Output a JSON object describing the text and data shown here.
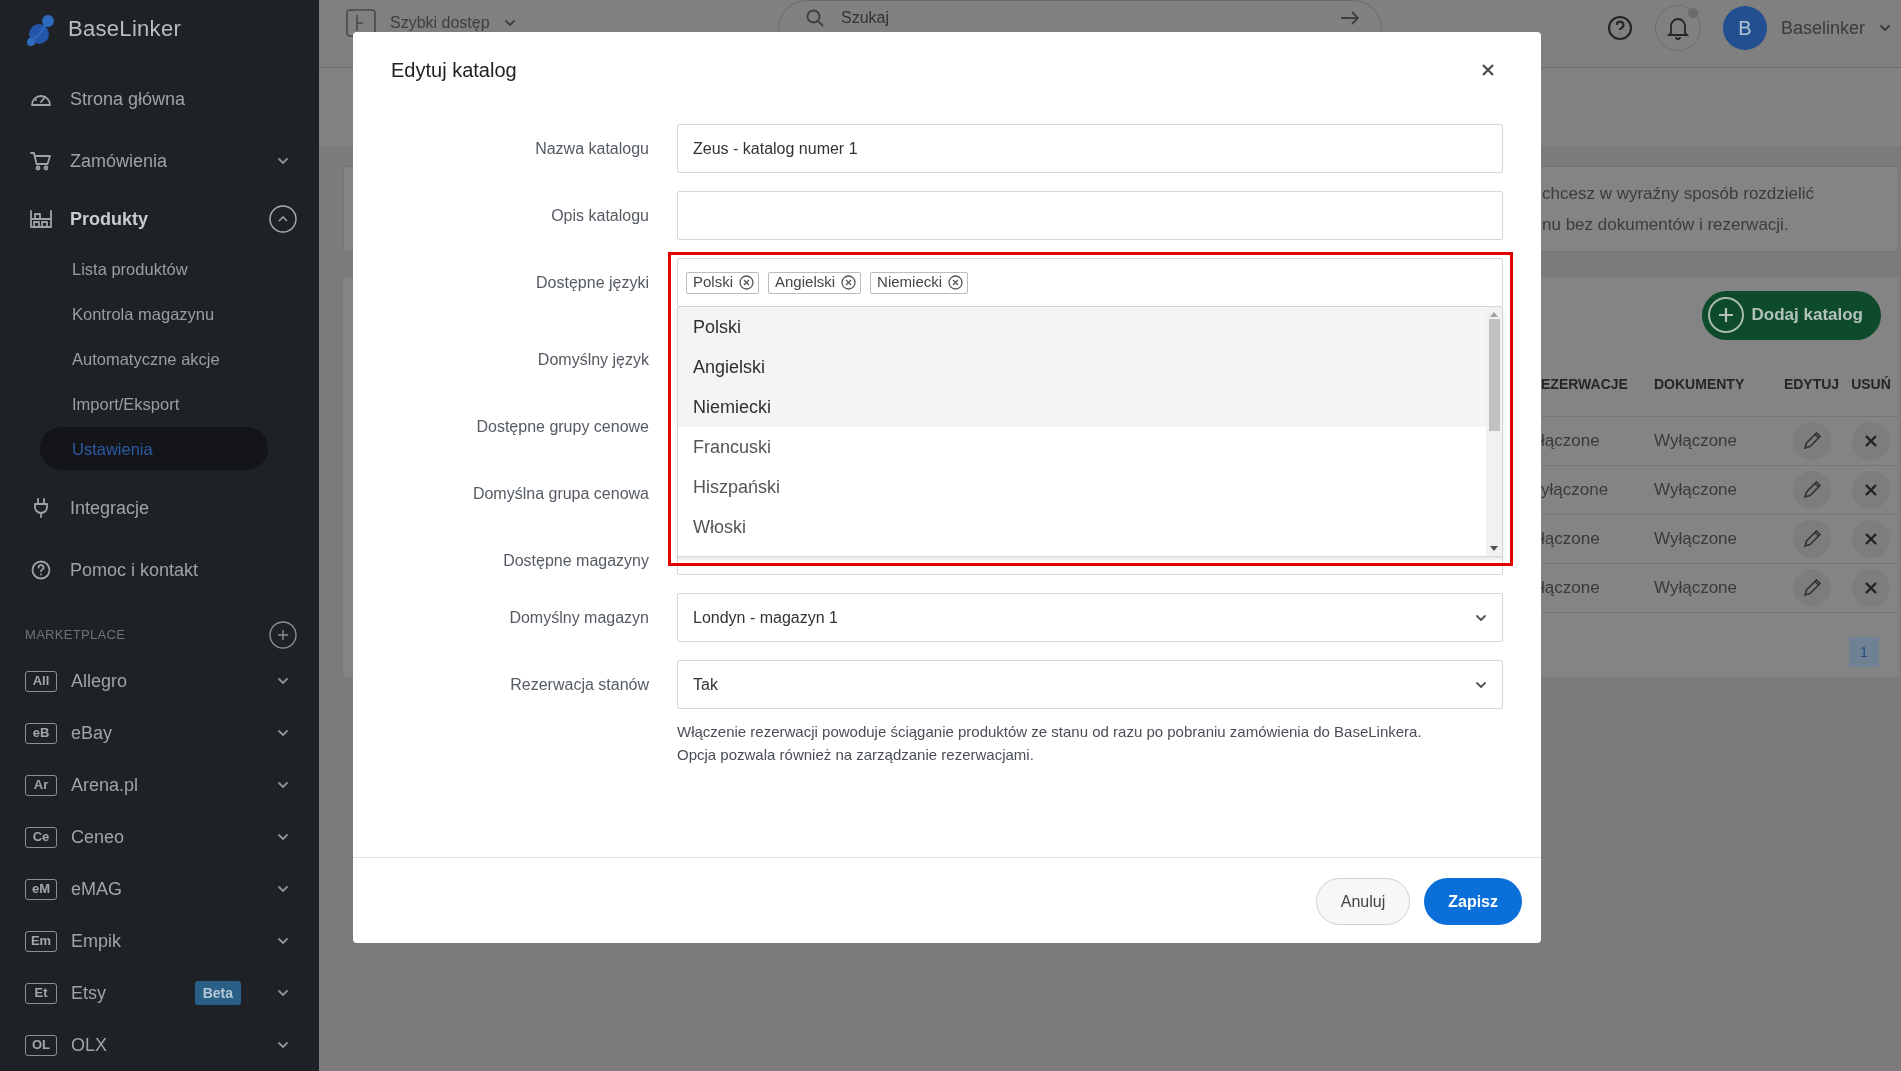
{
  "sidebar": {
    "logo": "BaseLinker",
    "nav": [
      {
        "label": "Strona główna",
        "kind": "link"
      },
      {
        "label": "Zamówienia",
        "kind": "group",
        "expanded": false
      },
      {
        "label": "Produkty",
        "kind": "group",
        "expanded": true,
        "children": [
          {
            "label": "Lista produktów",
            "selected": false
          },
          {
            "label": "Kontrola magazynu",
            "selected": false
          },
          {
            "label": "Automatyczne akcje",
            "selected": false
          },
          {
            "label": "Import/Eksport",
            "selected": false
          },
          {
            "label": "Ustawienia",
            "selected": true
          }
        ]
      },
      {
        "label": "Integracje",
        "kind": "link"
      },
      {
        "label": "Pomoc i kontakt",
        "kind": "link"
      }
    ],
    "marketplace": {
      "heading": "MARKETPLACE",
      "items": [
        {
          "badge": "All",
          "label": "Allegro"
        },
        {
          "badge": "eB",
          "label": "eBay"
        },
        {
          "badge": "Ar",
          "label": "Arena.pl"
        },
        {
          "badge": "Ce",
          "label": "Ceneo"
        },
        {
          "badge": "eM",
          "label": "eMAG"
        },
        {
          "badge": "Em",
          "label": "Empik"
        },
        {
          "badge": "Et",
          "label": "Etsy",
          "tag": "Beta"
        },
        {
          "badge": "OL",
          "label": "OLX"
        }
      ]
    }
  },
  "topbar": {
    "quick_access": "Szybki dostęp",
    "search": {
      "placeholder": "Szukaj"
    },
    "avatar": "B",
    "user": "Baselinker"
  },
  "background": {
    "info_lines": [
      "chcesz w wyraźny sposób rozdzielić",
      "nu bez dokumentów i rezerwacji."
    ],
    "add_button": "Dodaj katalog",
    "table": {
      "columns": [
        "EZERWACJE",
        "DOKUMENTY",
        "EDYTUJ",
        "USUŃ"
      ],
      "rows": [
        {
          "cells": [
            "łączone",
            "Wyłączone"
          ]
        },
        {
          "cells": [
            "yłączone",
            "Wyłączone"
          ]
        },
        {
          "cells": [
            "łączone",
            "Wyłączone"
          ]
        },
        {
          "cells": [
            "łączone",
            "Wyłączone"
          ]
        }
      ]
    },
    "pagination": [
      {
        "label": "1",
        "selected": true
      }
    ]
  },
  "modal": {
    "title": "Edytuj katalog",
    "fields": [
      {
        "label": "Nazwa katalogu",
        "kind": "text",
        "value": "Zeus - katalog numer 1"
      },
      {
        "label": "Opis katalogu",
        "kind": "text"
      },
      {
        "label": "Dostępne języki",
        "kind": "tags",
        "tags": [
          "Polski",
          "Angielski",
          "Niemiecki"
        ],
        "options": [
          {
            "label": "Polski",
            "selected": true
          },
          {
            "label": "Angielski",
            "selected": true
          },
          {
            "label": "Niemiecki",
            "selected": true
          },
          {
            "label": "Francuski",
            "selected": false
          },
          {
            "label": "Hiszpański",
            "selected": false
          },
          {
            "label": "Włoski",
            "selected": false
          }
        ]
      },
      {
        "label": "Domyślny język",
        "kind": "covered"
      },
      {
        "label": "Dostępne grupy cenowe",
        "kind": "covered"
      },
      {
        "label": "Domyślna grupa cenowa",
        "kind": "covered"
      },
      {
        "label": "Dostępne magazyny",
        "kind": "covered"
      },
      {
        "label": "Domyślny magazyn",
        "kind": "select",
        "value": "Londyn - magazyn 1"
      },
      {
        "label": "Rezerwacja stanów",
        "kind": "select",
        "value": "Tak",
        "help": "Włączenie rezerwacji powoduje ściąganie produktów ze stanu od razu po pobraniu zamówienia do BaseLinkera. Opcja pozwala również na zarządzanie rezerwacjami."
      }
    ],
    "buttons": [
      {
        "label": "Anuluj",
        "kind": "secondary"
      },
      {
        "label": "Zapisz",
        "kind": "primary"
      }
    ]
  }
}
